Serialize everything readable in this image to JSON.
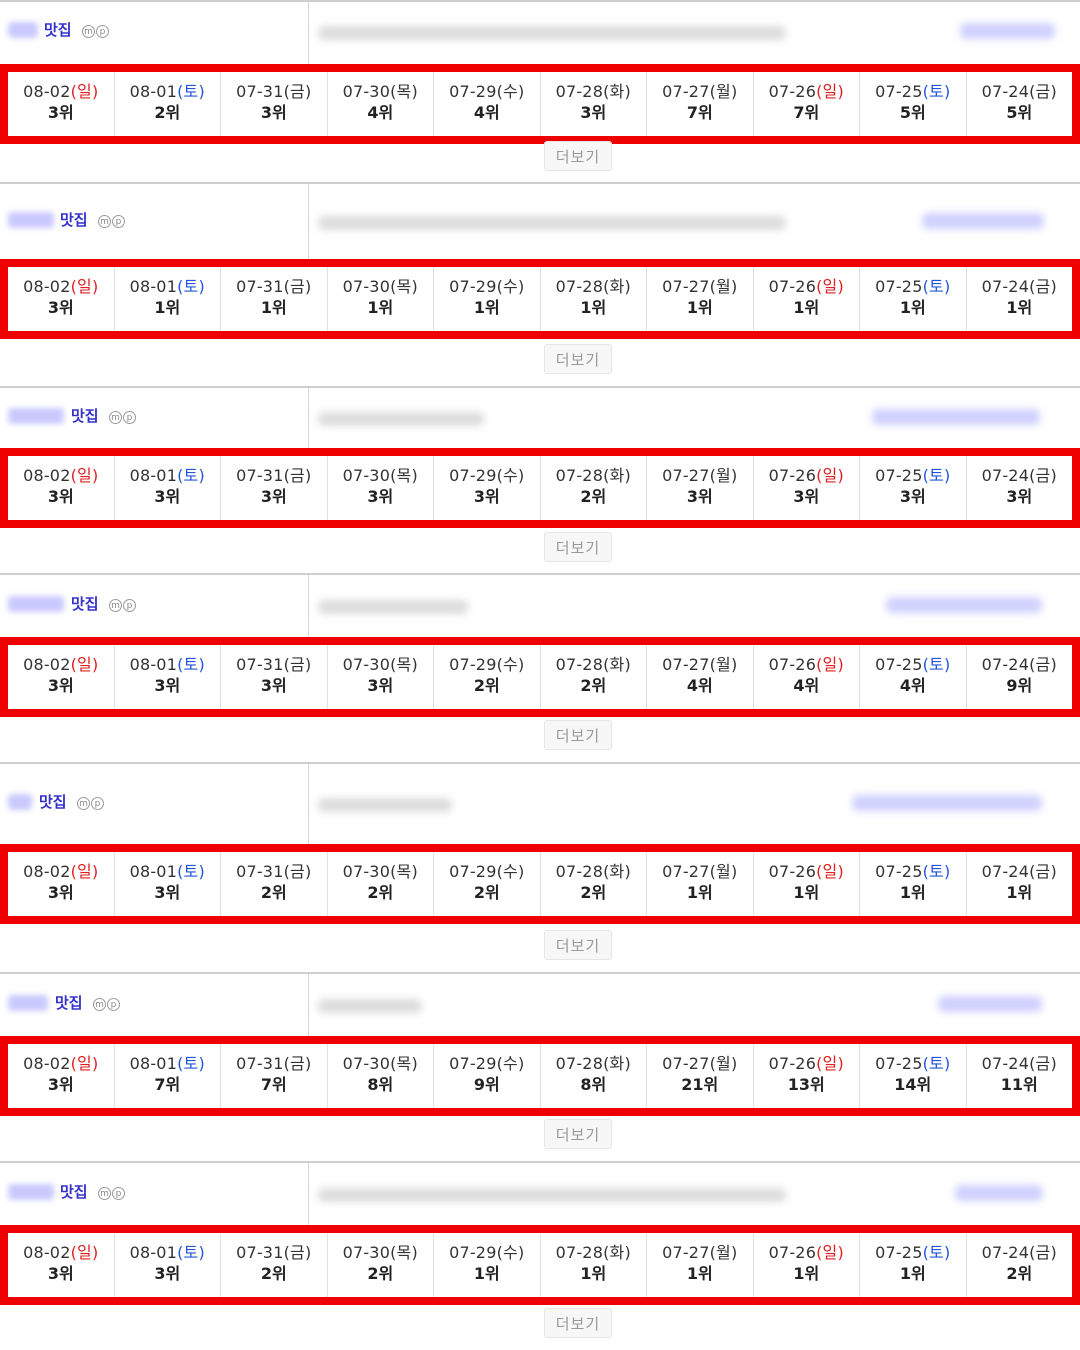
{
  "more_label": "더보기",
  "icons": {
    "m": "m",
    "p": "p"
  },
  "colors": {
    "highlight_border": "#ee0000",
    "sunday": "#e02020",
    "saturday": "#2255dd",
    "keyword": "#3333cc"
  },
  "dates": [
    {
      "date": "08-02",
      "dow": "일",
      "type": "sun"
    },
    {
      "date": "08-01",
      "dow": "토",
      "type": "sat"
    },
    {
      "date": "07-31",
      "dow": "금",
      "type": "wk"
    },
    {
      "date": "07-30",
      "dow": "목",
      "type": "wk"
    },
    {
      "date": "07-29",
      "dow": "수",
      "type": "wk"
    },
    {
      "date": "07-28",
      "dow": "화",
      "type": "wk"
    },
    {
      "date": "07-27",
      "dow": "월",
      "type": "wk"
    },
    {
      "date": "07-26",
      "dow": "일",
      "type": "sun"
    },
    {
      "date": "07-25",
      "dow": "토",
      "type": "sat"
    },
    {
      "date": "07-24",
      "dow": "금",
      "type": "wk"
    }
  ],
  "entries": [
    {
      "keyword": "맛집",
      "ranks": [
        "3위",
        "2위",
        "3위",
        "4위",
        "4위",
        "3위",
        "7위",
        "7위",
        "5위",
        "5위"
      ]
    },
    {
      "keyword": "맛집",
      "ranks": [
        "3위",
        "1위",
        "1위",
        "1위",
        "1위",
        "1위",
        "1위",
        "1위",
        "1위",
        "1위"
      ]
    },
    {
      "keyword": "맛집",
      "ranks": [
        "3위",
        "3위",
        "3위",
        "3위",
        "3위",
        "2위",
        "3위",
        "3위",
        "3위",
        "3위"
      ]
    },
    {
      "keyword": "맛집",
      "ranks": [
        "3위",
        "3위",
        "3위",
        "3위",
        "2위",
        "2위",
        "4위",
        "4위",
        "4위",
        "9위"
      ]
    },
    {
      "keyword": "맛집",
      "ranks": [
        "3위",
        "3위",
        "2위",
        "2위",
        "2위",
        "2위",
        "1위",
        "1위",
        "1위",
        "1위"
      ]
    },
    {
      "keyword": "맛집",
      "ranks": [
        "3위",
        "7위",
        "7위",
        "8위",
        "9위",
        "8위",
        "21위",
        "13위",
        "14위",
        "11위"
      ]
    },
    {
      "keyword": "맛집",
      "ranks": [
        "3위",
        "3위",
        "2위",
        "2위",
        "1위",
        "1위",
        "1위",
        "1위",
        "1위",
        "2위"
      ]
    }
  ]
}
